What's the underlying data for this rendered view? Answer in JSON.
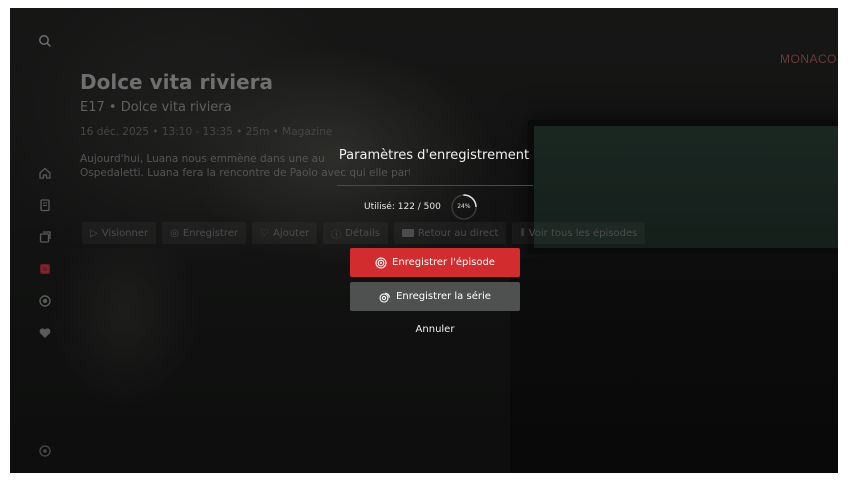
{
  "channel": {
    "logo_text": "MONACO"
  },
  "program": {
    "title": "Dolce vita riviera",
    "episode": "E17 • Dolce vita riviera",
    "meta": "16 déc. 2025  •  13:10 - 13:35  •  25m  •  Magazine",
    "description_line1": "Aujourd'hui, Luana nous emmène dans une au",
    "description_line2": "Ospedaletti. Luana fera la rencontre de Paolo avec qui elle partira sur l'un..."
  },
  "actions": [
    {
      "label": "Visionner",
      "icon": "play-icon"
    },
    {
      "label": "Enregistrer",
      "icon": "record-icon"
    },
    {
      "label": "Ajouter",
      "icon": "heart-add-icon"
    },
    {
      "label": "Détails",
      "icon": "info-icon"
    },
    {
      "label": "Retour au direct",
      "icon": "live-icon"
    },
    {
      "label": "Voir tous les épisodes",
      "icon": "library-icon"
    }
  ],
  "sidebar": {
    "icons": [
      "search-icon",
      "home-icon",
      "guide-icon",
      "replay-icon",
      "recordings-icon",
      "live-icon",
      "favorites-icon",
      "settings-icon"
    ],
    "active": "recordings-icon"
  },
  "modal": {
    "title": "Paramètres d'enregistrement",
    "usage_text": "Utilisé: 122 / 500",
    "usage_percent_label": "24%",
    "usage_fraction": 0.24,
    "record_episode_label": "Enregistrer l'épisode",
    "record_series_label": "Enregistrer la série",
    "cancel_label": "Annuler"
  },
  "colors": {
    "accent": "#d32c2e",
    "secondary_button": "#4f5150",
    "background": "#1c1d1c",
    "active_sidebar": "#7a1c22"
  }
}
